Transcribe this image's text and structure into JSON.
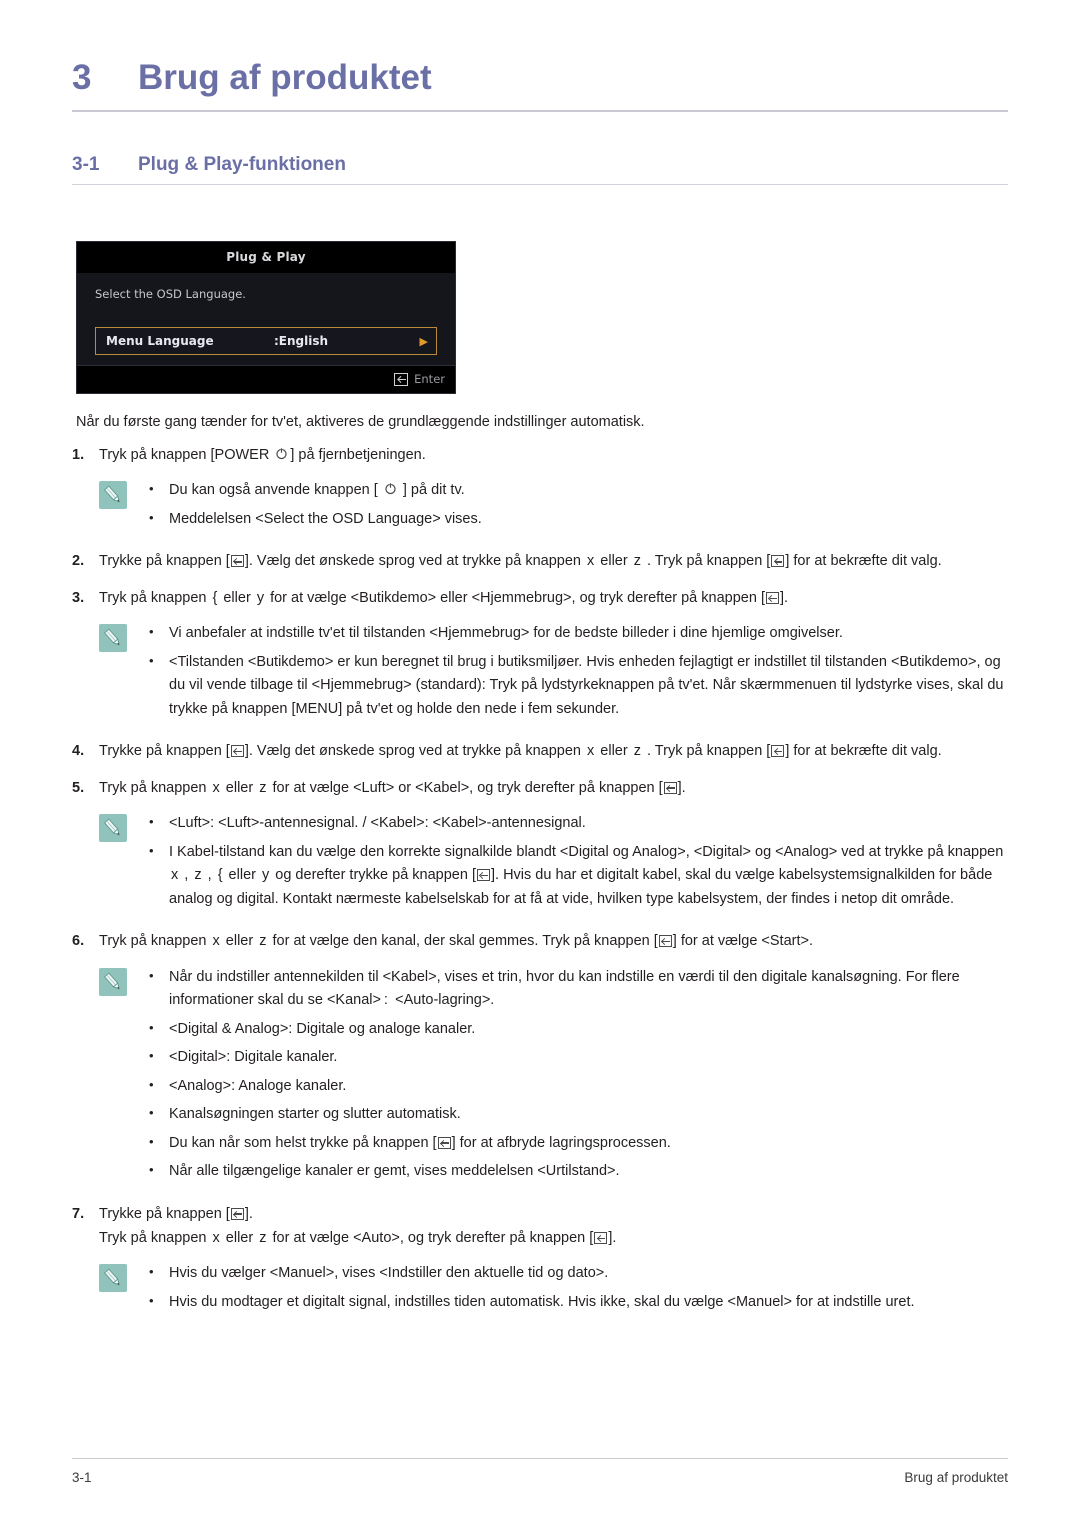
{
  "chapter": {
    "number": "3",
    "title": "Brug af produktet"
  },
  "section": {
    "number": "3-1",
    "title": "Plug & Play-funktionen"
  },
  "osd": {
    "title": "Plug & Play",
    "prompt": "Select the OSD Language.",
    "row_label": "Menu Language",
    "row_value": ":English",
    "row_arrow": "▶",
    "footer_label": "Enter",
    "enter_icon": "enter-key-icon",
    "border_color": "#b98a3a",
    "arrow_color": "#e09a2c",
    "background": "#15151c"
  },
  "intro": "Når du første gang tænder for tv'et, aktiveres de grundlæggende indstillinger automatisk.",
  "steps": [
    {
      "num": "1.",
      "parts": [
        {
          "t": "text",
          "v": "Tryk på knappen [POWER "
        },
        {
          "t": "power-icon"
        },
        {
          "t": "text",
          "v": "] på fjernbetjeningen."
        }
      ],
      "note": {
        "icon": "pencil-note-icon",
        "items": [
          [
            {
              "t": "text",
              "v": "Du kan også anvende knappen [ "
            },
            {
              "t": "power-icon"
            },
            {
              "t": "text",
              "v": " ] på dit tv."
            }
          ],
          [
            {
              "t": "text",
              "v": "Meddelelsen <Select the OSD Language> vises."
            }
          ]
        ]
      }
    },
    {
      "num": "2.",
      "parts": [
        {
          "t": "text",
          "v": "Trykke på knappen ["
        },
        {
          "t": "enter-icon"
        },
        {
          "t": "text",
          "v": "]. Vælg det ønskede sprog ved at trykke på knappen "
        },
        {
          "t": "key",
          "v": "x"
        },
        {
          "t": "text",
          "v": " eller "
        },
        {
          "t": "key",
          "v": "z"
        },
        {
          "t": "text",
          "v": " . Tryk på knappen ["
        },
        {
          "t": "enter-icon"
        },
        {
          "t": "text",
          "v": "] for at bekræfte dit valg."
        }
      ]
    },
    {
      "num": "3.",
      "parts": [
        {
          "t": "text",
          "v": "Tryk på knappen "
        },
        {
          "t": "key",
          "v": "{"
        },
        {
          "t": "text",
          "v": " eller "
        },
        {
          "t": "key",
          "v": "y"
        },
        {
          "t": "text",
          "v": " for at vælge <Butikdemo> eller <Hjemmebrug>, og tryk derefter på knappen ["
        },
        {
          "t": "enter-icon"
        },
        {
          "t": "text",
          "v": "]."
        }
      ],
      "note": {
        "icon": "pencil-note-icon",
        "items": [
          [
            {
              "t": "text",
              "v": "Vi anbefaler at indstille tv'et til tilstanden <Hjemmebrug> for de bedste billeder i dine hjemlige omgivelser."
            }
          ],
          [
            {
              "t": "text",
              "v": "<Tilstanden <Butikdemo> er kun beregnet til brug i butiksmiljøer. Hvis enheden fejlagtigt er indstillet til tilstanden <Butikdemo>, og du vil vende tilbage til <Hjemmebrug> (standard): Tryk på lydstyrkeknappen på tv'et. Når skærmmenuen til lydstyrke vises, skal du trykke på knappen [MENU] på tv'et og holde den nede i fem sekunder."
            }
          ]
        ]
      }
    },
    {
      "num": "4.",
      "parts": [
        {
          "t": "text",
          "v": "Trykke på knappen ["
        },
        {
          "t": "enter-icon"
        },
        {
          "t": "text",
          "v": "]. Vælg det ønskede sprog ved at trykke på knappen "
        },
        {
          "t": "key",
          "v": "x"
        },
        {
          "t": "text",
          "v": " eller "
        },
        {
          "t": "key",
          "v": "z"
        },
        {
          "t": "text",
          "v": " . Tryk på knappen ["
        },
        {
          "t": "enter-icon"
        },
        {
          "t": "text",
          "v": "] for at bekræfte dit valg."
        }
      ]
    },
    {
      "num": "5.",
      "parts": [
        {
          "t": "text",
          "v": "Tryk på knappen "
        },
        {
          "t": "key",
          "v": "x"
        },
        {
          "t": "text",
          "v": " eller "
        },
        {
          "t": "key",
          "v": "z"
        },
        {
          "t": "text",
          "v": " for at vælge <Luft> or <Kabel>, og tryk derefter på knappen ["
        },
        {
          "t": "enter-icon"
        },
        {
          "t": "text",
          "v": "]."
        }
      ],
      "note": {
        "icon": "pencil-note-icon",
        "items": [
          [
            {
              "t": "text",
              "v": "<Luft>: <Luft>-antennesignal. / <Kabel>: <Kabel>-antennesignal."
            }
          ],
          [
            {
              "t": "text",
              "v": "I Kabel-tilstand kan du vælge den korrekte signalkilde blandt <Digital og Analog>, <Digital> og <Analog> ved at trykke på knappen "
            },
            {
              "t": "key",
              "v": "x"
            },
            {
              "t": "text",
              "v": " , "
            },
            {
              "t": "key",
              "v": "z"
            },
            {
              "t": "text",
              "v": " , "
            },
            {
              "t": "key",
              "v": "{"
            },
            {
              "t": "text",
              "v": " eller "
            },
            {
              "t": "key",
              "v": "y"
            },
            {
              "t": "text",
              "v": " og derefter trykke på knappen ["
            },
            {
              "t": "enter-icon"
            },
            {
              "t": "text",
              "v": "]. Hvis du har et digitalt kabel, skal du vælge kabelsystemsignalkilden for både analog og digital. Kontakt nærmeste kabelselskab for at få at vide, hvilken type kabelsystem, der findes i netop dit område."
            }
          ]
        ]
      }
    },
    {
      "num": "6.",
      "parts": [
        {
          "t": "text",
          "v": "Tryk på knappen "
        },
        {
          "t": "key",
          "v": "x"
        },
        {
          "t": "text",
          "v": " eller "
        },
        {
          "t": "key",
          "v": "z"
        },
        {
          "t": "text",
          "v": " for at vælge den kanal, der skal gemmes. Tryk på knappen ["
        },
        {
          "t": "enter-icon"
        },
        {
          "t": "text",
          "v": "] for at vælge <Start>."
        }
      ],
      "note": {
        "icon": "pencil-note-icon",
        "items": [
          [
            {
              "t": "text",
              "v": "Når du indstiller antennekilden til <Kabel>, vises et trin, hvor du kan indstille en værdi til den digitale kanalsøgning. For flere informationer skal du se <Kanal> : <Auto-lagring>."
            }
          ],
          [
            {
              "t": "text",
              "v": "<Digital & Analog>: Digitale og analoge kanaler."
            }
          ],
          [
            {
              "t": "text",
              "v": "<Digital>: Digitale kanaler."
            }
          ],
          [
            {
              "t": "text",
              "v": "<Analog>: Analoge kanaler."
            }
          ],
          [
            {
              "t": "text",
              "v": "Kanalsøgningen starter og slutter automatisk."
            }
          ],
          [
            {
              "t": "text",
              "v": "Du kan når som helst trykke på knappen ["
            },
            {
              "t": "enter-icon"
            },
            {
              "t": "text",
              "v": "] for at afbryde lagringsprocessen."
            }
          ],
          [
            {
              "t": "text",
              "v": "Når alle tilgængelige kanaler er gemt, vises meddelelsen <Urtilstand>."
            }
          ]
        ]
      }
    },
    {
      "num": "7.",
      "parts": [
        {
          "t": "text",
          "v": "Trykke på knappen ["
        },
        {
          "t": "enter-icon"
        },
        {
          "t": "text",
          "v": "]."
        }
      ],
      "sub": [
        {
          "t": "text",
          "v": "Tryk på knappen "
        },
        {
          "t": "key",
          "v": "x"
        },
        {
          "t": "text",
          "v": " eller "
        },
        {
          "t": "key",
          "v": "z"
        },
        {
          "t": "text",
          "v": " for at vælge <Auto>, og tryk derefter på knappen ["
        },
        {
          "t": "enter-icon"
        },
        {
          "t": "text",
          "v": "]."
        }
      ],
      "note": {
        "icon": "pencil-note-icon",
        "items": [
          [
            {
              "t": "text",
              "v": "Hvis du vælger <Manuel>, vises <Indstiller den aktuelle tid og dato>."
            }
          ],
          [
            {
              "t": "text",
              "v": "Hvis du modtager et digitalt signal, indstilles tiden automatisk. Hvis ikke, skal du vælge <Manuel> for at indstille uret."
            }
          ]
        ]
      }
    }
  ],
  "footer": {
    "left": "3-1",
    "right": "Brug af produktet"
  },
  "colors": {
    "heading": "#6a6fa6",
    "note_badge": "#8fc3bb",
    "text": "#231f20"
  }
}
